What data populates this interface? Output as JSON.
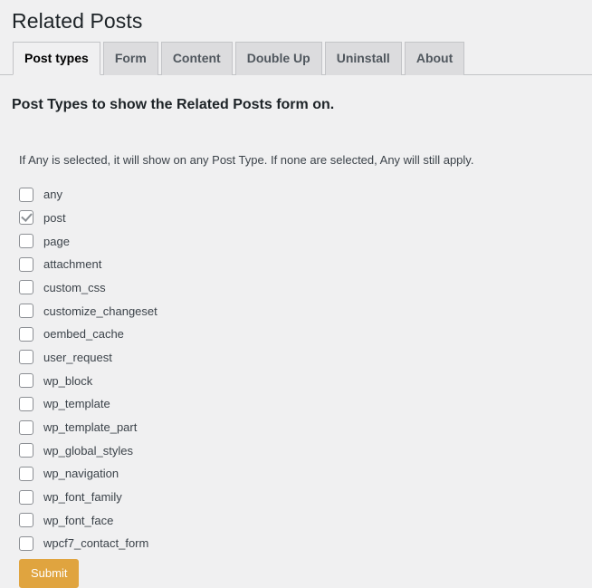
{
  "page": {
    "title": "Related Posts"
  },
  "tabs": [
    {
      "label": "Post types",
      "active": true
    },
    {
      "label": "Form",
      "active": false
    },
    {
      "label": "Content",
      "active": false
    },
    {
      "label": "Double Up",
      "active": false
    },
    {
      "label": "Uninstall",
      "active": false
    },
    {
      "label": "About",
      "active": false
    }
  ],
  "content": {
    "heading": "Post Types to show the Related Posts form on.",
    "intro": "If Any is selected, it will show on any Post Type. If none are selected, Any will still apply."
  },
  "post_types": [
    {
      "label": "any",
      "checked": false
    },
    {
      "label": "post",
      "checked": true
    },
    {
      "label": "page",
      "checked": false
    },
    {
      "label": "attachment",
      "checked": false
    },
    {
      "label": "custom_css",
      "checked": false
    },
    {
      "label": "customize_changeset",
      "checked": false
    },
    {
      "label": "oembed_cache",
      "checked": false
    },
    {
      "label": "user_request",
      "checked": false
    },
    {
      "label": "wp_block",
      "checked": false
    },
    {
      "label": "wp_template",
      "checked": false
    },
    {
      "label": "wp_template_part",
      "checked": false
    },
    {
      "label": "wp_global_styles",
      "checked": false
    },
    {
      "label": "wp_navigation",
      "checked": false
    },
    {
      "label": "wp_font_family",
      "checked": false
    },
    {
      "label": "wp_font_face",
      "checked": false
    },
    {
      "label": "wpcf7_contact_form",
      "checked": false
    }
  ],
  "form": {
    "submit_label": "Submit"
  },
  "colors": {
    "background": "#f0f0f1",
    "tab_inactive": "#dcdcde",
    "tab_border": "#c3c4c7",
    "submit_button": "#e0a43f",
    "text": "#3c434a"
  }
}
